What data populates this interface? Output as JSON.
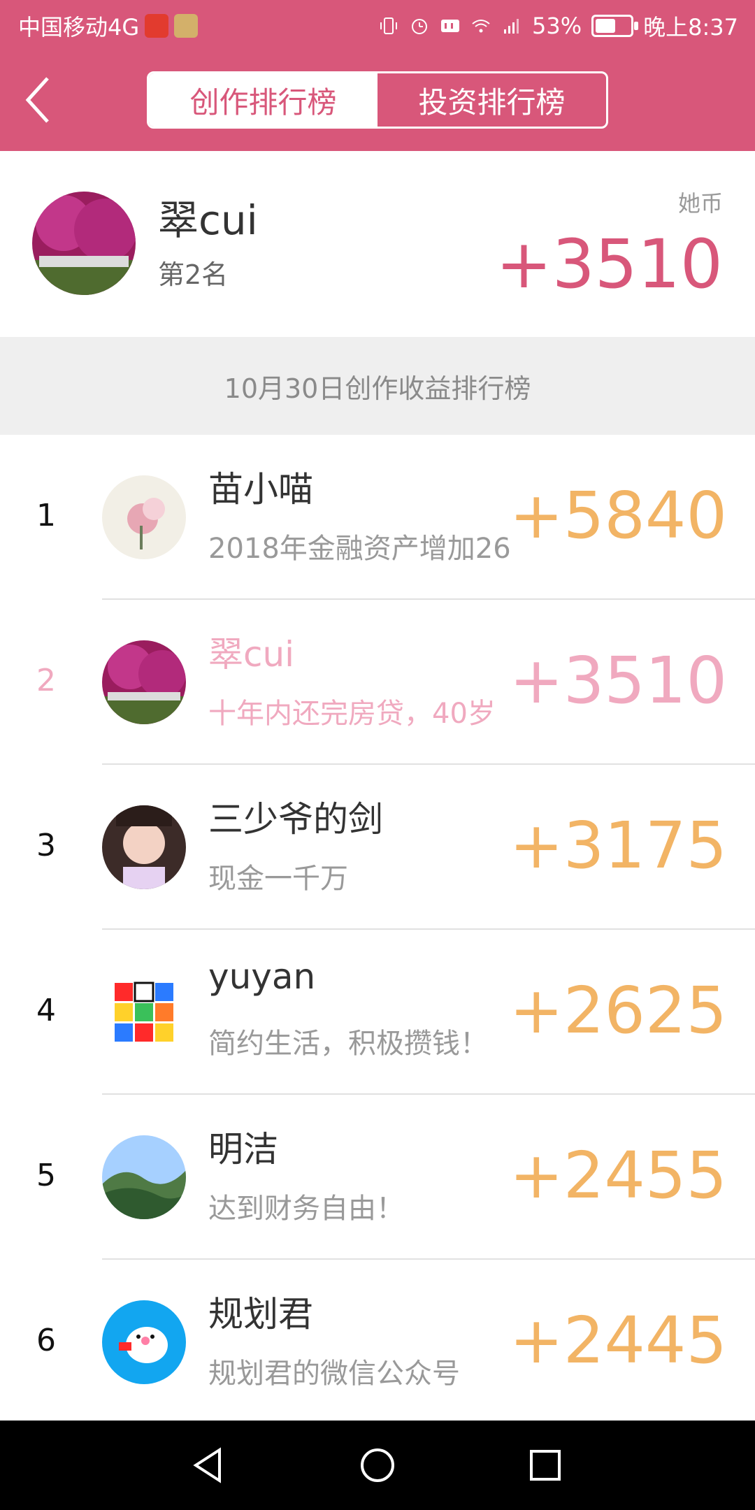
{
  "status": {
    "carrier": "中国移动4G",
    "battery": "53%",
    "time": "晚上8:37"
  },
  "header": {
    "tabs": [
      {
        "label": "创作排行榜",
        "active": true
      },
      {
        "label": "投资排行榜",
        "active": false
      }
    ]
  },
  "me": {
    "name": "翠cui",
    "rank_text": "第2名",
    "unit": "她币",
    "score": "+3510"
  },
  "section": {
    "title": "10月30日创作收益排行榜"
  },
  "list": [
    {
      "index": "1",
      "name": "苗小喵",
      "subtitle": "2018年金融资产增加26",
      "score": "+5840"
    },
    {
      "index": "2",
      "name": "翠cui",
      "subtitle": "十年内还完房贷，40岁",
      "score": "+3510",
      "is_me": true
    },
    {
      "index": "3",
      "name": "三少爷的剑",
      "subtitle": "现金一千万",
      "score": "+3175"
    },
    {
      "index": "4",
      "name": "yuyan",
      "subtitle": "简约生活，积极攒钱！",
      "score": "+2625"
    },
    {
      "index": "5",
      "name": "明洁",
      "subtitle": "达到财务自由！",
      "score": "+2455"
    },
    {
      "index": "6",
      "name": "规划君",
      "subtitle": "规划君的微信公众号",
      "score": "+2445"
    }
  ],
  "colors": {
    "brand": "#d8577a",
    "score_orange": "#f2b465",
    "me_pink": "#f0a9bf"
  },
  "icons": {
    "back": "chevron-left-icon",
    "nav": [
      "back-triangle-icon",
      "home-circle-icon",
      "recent-square-icon"
    ]
  }
}
